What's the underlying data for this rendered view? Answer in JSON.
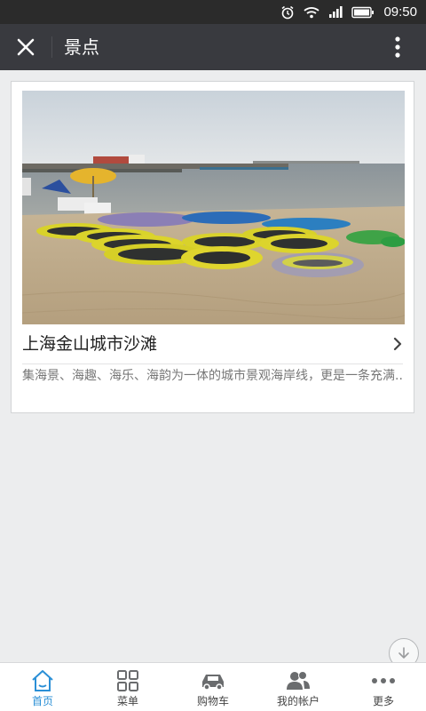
{
  "status_bar": {
    "time": "09:50"
  },
  "header": {
    "title": "景点"
  },
  "card": {
    "title": "上海金山城市沙滩",
    "description": "集海景、海趣、海乐、海韵为一体的城市景观海岸线，更是一条充满.."
  },
  "bottom_nav": {
    "items": [
      {
        "label": "首页",
        "icon": "home-icon",
        "active": true
      },
      {
        "label": "菜单",
        "icon": "grid-icon",
        "active": false
      },
      {
        "label": "购物车",
        "icon": "car-icon",
        "active": false
      },
      {
        "label": "我的帐户",
        "icon": "users-icon",
        "active": false
      },
      {
        "label": "更多",
        "icon": "more-dots-icon",
        "active": false
      }
    ]
  },
  "colors": {
    "header_bg": "#393a3f",
    "accent": "#2a8fd6",
    "page_bg": "#ecedee"
  }
}
